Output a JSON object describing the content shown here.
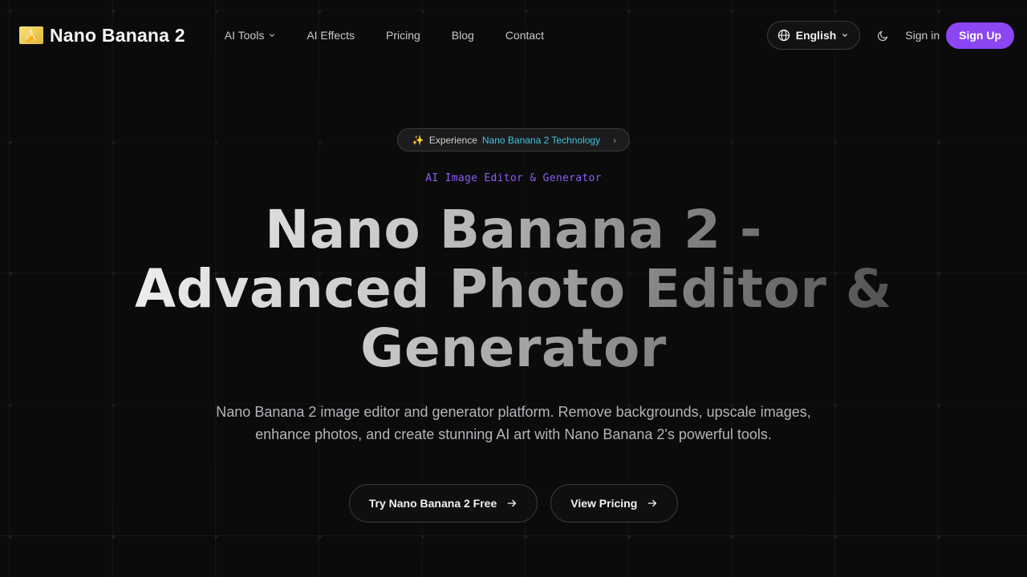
{
  "brand": {
    "name": "Nano Banana 2",
    "logo_icon": "banana-emoji-icon"
  },
  "nav": {
    "links": [
      {
        "label": "AI Tools",
        "has_dropdown": true
      },
      {
        "label": "AI Effects",
        "has_dropdown": false
      },
      {
        "label": "Pricing",
        "has_dropdown": false
      },
      {
        "label": "Blog",
        "has_dropdown": false
      },
      {
        "label": "Contact",
        "has_dropdown": false
      }
    ]
  },
  "header_right": {
    "language": "English",
    "theme_icon": "moon-icon",
    "sign_in": "Sign in",
    "sign_up": "Sign Up"
  },
  "hero": {
    "pill": {
      "prefix": "Experience",
      "accent": "Nano Banana 2 Technology",
      "icon": "sparkles-icon"
    },
    "eyebrow": "AI Image Editor & Generator",
    "headline": "Nano Banana 2 - Advanced Photo Editor & Generator",
    "subtitle": "Nano Banana 2 image editor and generator platform. Remove backgrounds, upscale images, enhance photos, and create stunning AI art with Nano Banana 2's powerful tools.",
    "primary_cta": "Try Nano Banana 2 Free",
    "secondary_cta": "View Pricing"
  },
  "colors": {
    "background": "#0b0b0c",
    "accent_purple": "#8b45f3",
    "accent_cyan": "#3ec4dc",
    "eyebrow_purple": "#8e5cf6"
  }
}
